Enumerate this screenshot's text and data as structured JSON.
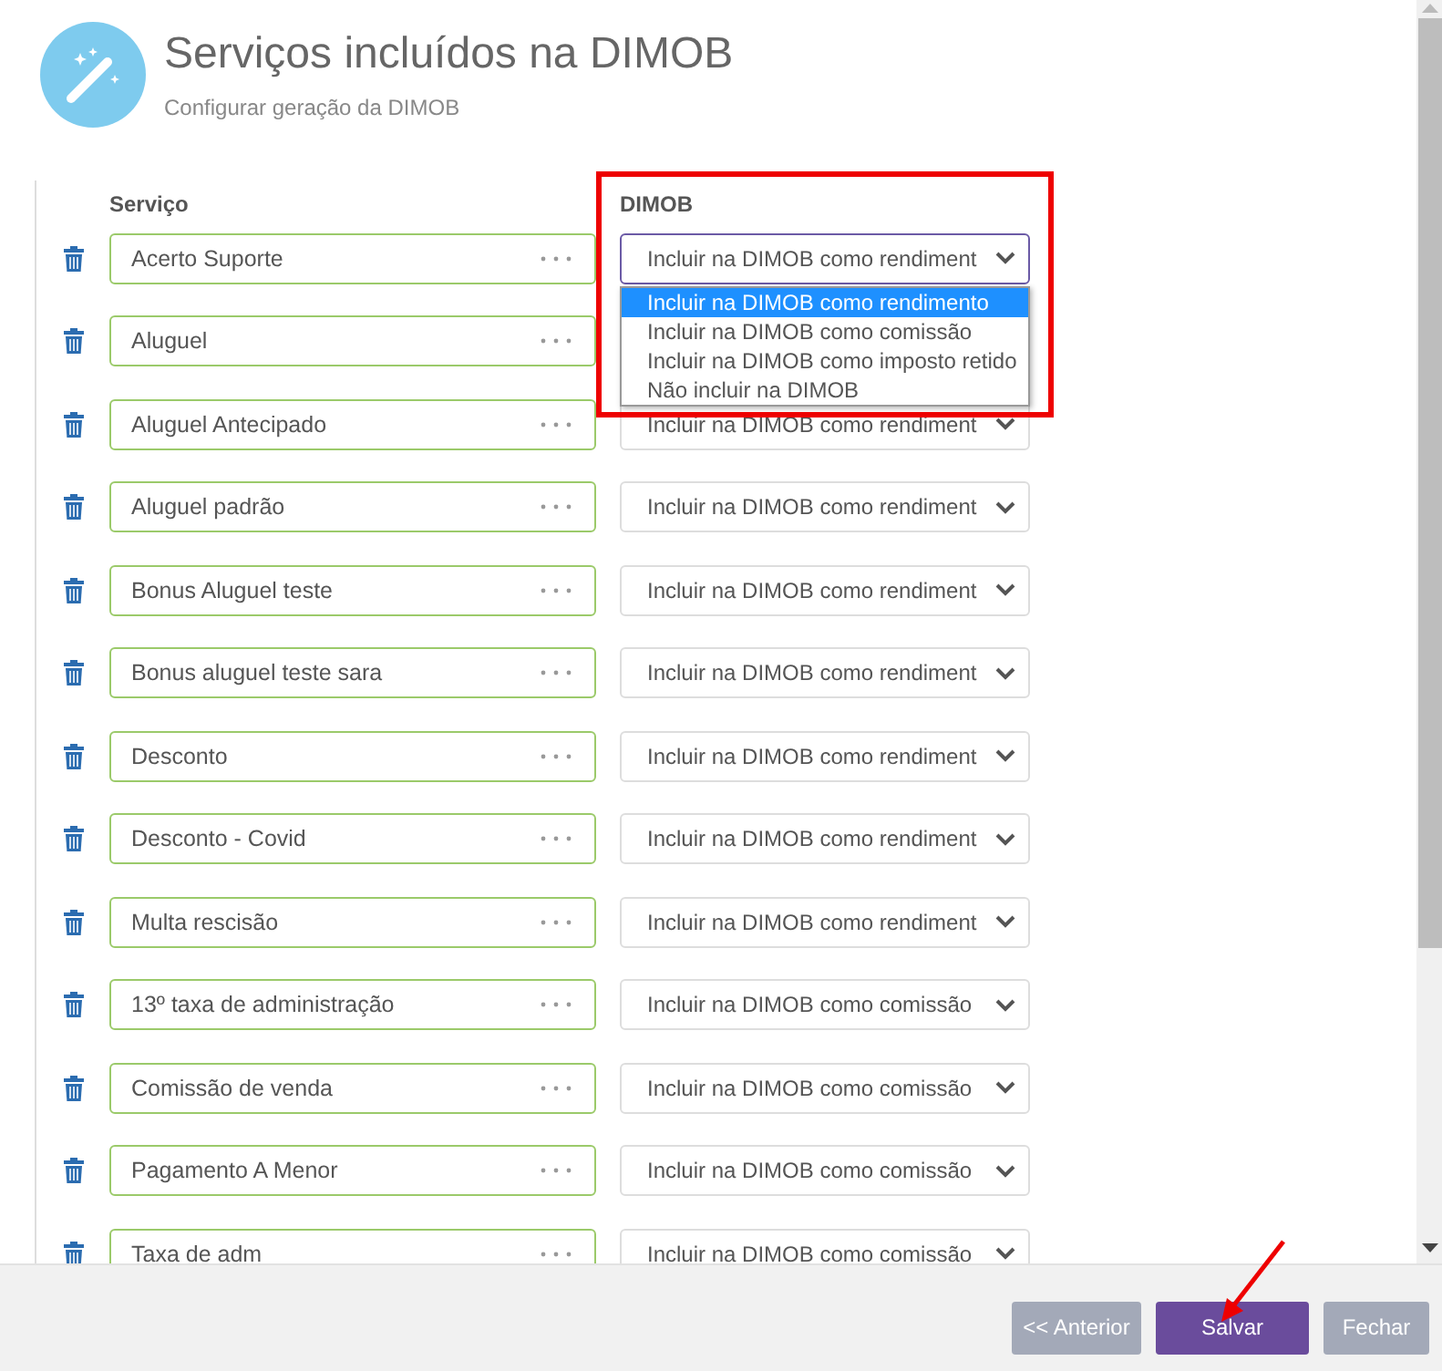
{
  "header": {
    "title": "Serviços incluídos na DIMOB",
    "subtitle": "Configurar geração da DIMOB"
  },
  "columns": {
    "service": "Serviço",
    "dimob": "DIMOB"
  },
  "rows": [
    {
      "service": "Acerto Suporte",
      "dimob": "Incluir na DIMOB como rendiment",
      "dropdown": {
        "options": [
          {
            "label": "Incluir na DIMOB como rendimento",
            "selected": true
          },
          {
            "label": "Incluir na DIMOB como comissão",
            "selected": false
          },
          {
            "label": "Incluir na DIMOB como imposto retido",
            "selected": false
          },
          {
            "label": "Não incluir na DIMOB",
            "selected": false
          }
        ]
      }
    },
    {
      "service": "Aluguel"
    },
    {
      "service": "Aluguel Antecipado",
      "dimob": "Incluir na DIMOB como rendiment"
    },
    {
      "service": "Aluguel padrão",
      "dimob": "Incluir na DIMOB como rendiment"
    },
    {
      "service": "Bonus Aluguel teste",
      "dimob": "Incluir na DIMOB como rendiment"
    },
    {
      "service": "Bonus aluguel teste sara",
      "dimob": "Incluir na DIMOB como rendiment"
    },
    {
      "service": "Desconto",
      "dimob": "Incluir na DIMOB como rendiment"
    },
    {
      "service": "Desconto - Covid",
      "dimob": "Incluir na DIMOB como rendiment"
    },
    {
      "service": "Multa rescisão",
      "dimob": "Incluir na DIMOB como rendiment"
    },
    {
      "service": "13º taxa de administração",
      "dimob": "Incluir na DIMOB como comissão"
    },
    {
      "service": "Comissão de venda",
      "dimob": "Incluir na DIMOB como comissão"
    },
    {
      "service": "Pagamento A Menor",
      "dimob": "Incluir na DIMOB como comissão"
    },
    {
      "service": "Taxa de adm",
      "dimob": "Incluir na DIMOB como comissão"
    }
  ],
  "buttons": [
    {
      "label": "<< Anterior",
      "disabled": true
    },
    {
      "label": "Salvar",
      "disabled": false
    },
    {
      "label": "Fechar",
      "disabled": true
    }
  ]
}
